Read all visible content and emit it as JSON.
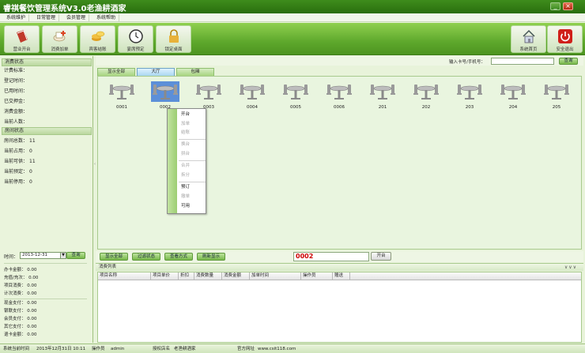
{
  "window": {
    "title": "睿祺餐饮管理系统V3.0老渔耕酒家",
    "minimize_label": "_",
    "close_label": "×"
  },
  "menu": [
    "系统维护",
    "日常管理",
    "会员管理",
    "系统帮助"
  ],
  "toolbar": {
    "buttons": [
      {
        "label": "营业开台",
        "icon": "book-icon",
        "color": "#c0392b"
      },
      {
        "label": "消费加单",
        "icon": "teacup-icon",
        "color": "#d64f2a"
      },
      {
        "label": "宾客结账",
        "icon": "coins-icon",
        "color": "#e0a020"
      },
      {
        "label": "宴席预定",
        "icon": "clock-icon",
        "color": "#444444"
      },
      {
        "label": "锁定桌面",
        "icon": "lock-icon",
        "color": "#e8b23a"
      }
    ],
    "right_buttons": [
      {
        "label": "系统首页",
        "icon": "home-icon",
        "color": "#6a7fa5"
      },
      {
        "label": "安全退出",
        "icon": "power-icon",
        "color": "#d0201a"
      }
    ]
  },
  "consumption_status": {
    "header": "消费状态",
    "items": [
      {
        "label": "计费标准：",
        "value": ""
      },
      {
        "label": "登记时间：",
        "value": ""
      },
      {
        "label": "已用时间：",
        "value": ""
      },
      {
        "label": "已交押金：",
        "value": ""
      },
      {
        "label": "消费金额：",
        "value": ""
      },
      {
        "label": "当前人数：",
        "value": ""
      }
    ]
  },
  "room_status": {
    "header": "房间状态",
    "items": [
      {
        "label": "房间总数：",
        "value": "11"
      },
      {
        "label": "当前占用：",
        "value": "0"
      },
      {
        "label": "当前可供：",
        "value": "11"
      },
      {
        "label": "当前预定：",
        "value": "0"
      },
      {
        "label": "当前停用：",
        "value": "0"
      }
    ]
  },
  "time_filter": {
    "label": "时间：",
    "value": "2013-12-31",
    "dropdown": "▼",
    "button": "查询"
  },
  "payments": {
    "group1": [
      {
        "label": "办卡金额：",
        "value": "0.00"
      },
      {
        "label": "充值/充次：",
        "value": "0.00"
      },
      {
        "label": "项目消费：",
        "value": "0.00"
      },
      {
        "label": "计次消费：",
        "value": "0.00"
      }
    ],
    "group2": [
      {
        "label": "现金支付：",
        "value": "0.00"
      },
      {
        "label": "银联支付：",
        "value": "0.00"
      },
      {
        "label": "会员支付：",
        "value": "0.00"
      },
      {
        "label": "其它支付：",
        "value": "0.00"
      },
      {
        "label": "退卡金额：",
        "value": "0.00"
      }
    ]
  },
  "card_search": {
    "label": "输入卡号/手机号：",
    "value": "",
    "button": "查询"
  },
  "tabs": [
    {
      "label": "显示全部",
      "active": false
    },
    {
      "label": "大厅",
      "active": true
    },
    {
      "label": "包厢",
      "active": false
    }
  ],
  "tables": [
    "0001",
    "0002",
    "0003",
    "0004",
    "0005",
    "0006",
    "201",
    "202",
    "203",
    "204",
    "205"
  ],
  "selected_table": "0002",
  "context_menu": [
    {
      "label": "开台",
      "enabled": true
    },
    {
      "label": "加单",
      "enabled": false
    },
    {
      "label": "结账",
      "enabled": false
    },
    {
      "label": "换台",
      "enabled": false
    },
    {
      "label": "拼台",
      "enabled": false
    },
    {
      "label": "合并",
      "enabled": false
    },
    {
      "label": "拆分",
      "enabled": false
    },
    {
      "label": "预订",
      "enabled": true
    },
    {
      "label": "撤单",
      "enabled": false
    },
    {
      "label": "可用",
      "enabled": true
    }
  ],
  "controls": {
    "buttons": [
      "显示全部",
      "过滤状态",
      "查看方式",
      "刷新显示"
    ],
    "table_input": "0002",
    "open_button": "开台"
  },
  "consumption_list": {
    "header": "消费列表",
    "collapse": "∨∨∨",
    "columns": [
      "项目名称",
      "项目单价",
      "折扣",
      "消费数量",
      "消费金额",
      "加单时间",
      "操作员",
      "赠送"
    ]
  },
  "statusbar": {
    "time_label": "系统当前时间",
    "time_value": "2013年12月31日 10:11",
    "operator_label": "操作员",
    "operator_value": "admin",
    "store_label": "授权店名",
    "store_value": "老渔耕酒家",
    "site_label": "官方网址",
    "site_value": "www.csit118.com"
  }
}
